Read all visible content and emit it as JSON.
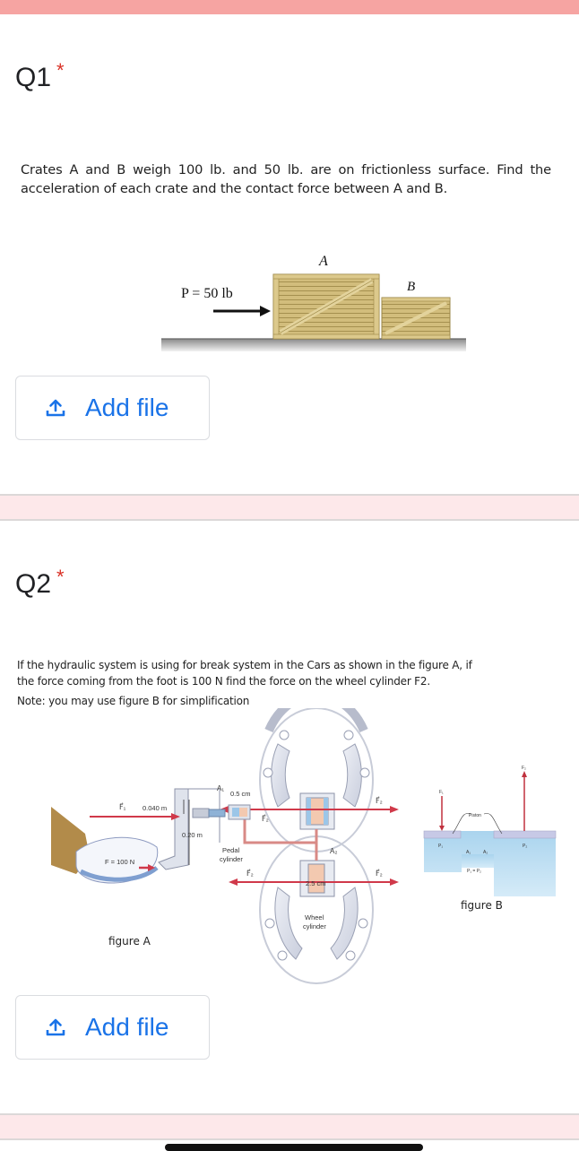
{
  "header": {
    "accent_color": "#f6a4a2"
  },
  "questions": [
    {
      "title": "Q1",
      "required_marker": "*",
      "text": "Crates A and B weigh 100 lb. and 50 lb. are on frictionless surface. Find the acceleration of each crate and the contact force between A and B.",
      "figure": {
        "force_label": "P = 50 lb",
        "crate_a_label": "A",
        "crate_b_label": "B"
      },
      "upload_button": {
        "icon": "upload-icon",
        "label": "Add file"
      }
    },
    {
      "title": "Q2",
      "required_marker": "*",
      "text": "If the hydraulic system is using for break system in the Cars as shown in the figure A, if the force coming from the foot is 100 N find the force on the wheel cylinder F2.",
      "note": "Note: you may use figure B for simplification",
      "figure_a": {
        "caption": "figure A",
        "labels": {
          "f1": "F⃗₁",
          "d1": "0.040 m",
          "d2": "0.20 m",
          "foot_force": "F = 100 N",
          "a1": "A₁",
          "pedal_diam": "0.5 cm",
          "pedal_cyl_1": "Pedal",
          "pedal_cyl_2": "cylinder",
          "f2": "F⃗₂",
          "a2": "A₂",
          "wheel_diam": "2.5 cm",
          "wheel_cyl_1": "Wheel",
          "wheel_cyl_2": "cylinder"
        }
      },
      "figure_b": {
        "caption": "figure B",
        "labels": {
          "f1": "F₁",
          "f2": "F₂",
          "piston": "Piston",
          "p1": "P₁",
          "p2": "P₂",
          "a1": "A₁",
          "a2": "A₂",
          "equality": "P₁ = P₂"
        }
      },
      "upload_button": {
        "icon": "upload-icon",
        "label": "Add file"
      }
    }
  ],
  "colors": {
    "required": "#d93025",
    "link_blue": "#1a73e8",
    "divider_band": "#fde8ea"
  }
}
